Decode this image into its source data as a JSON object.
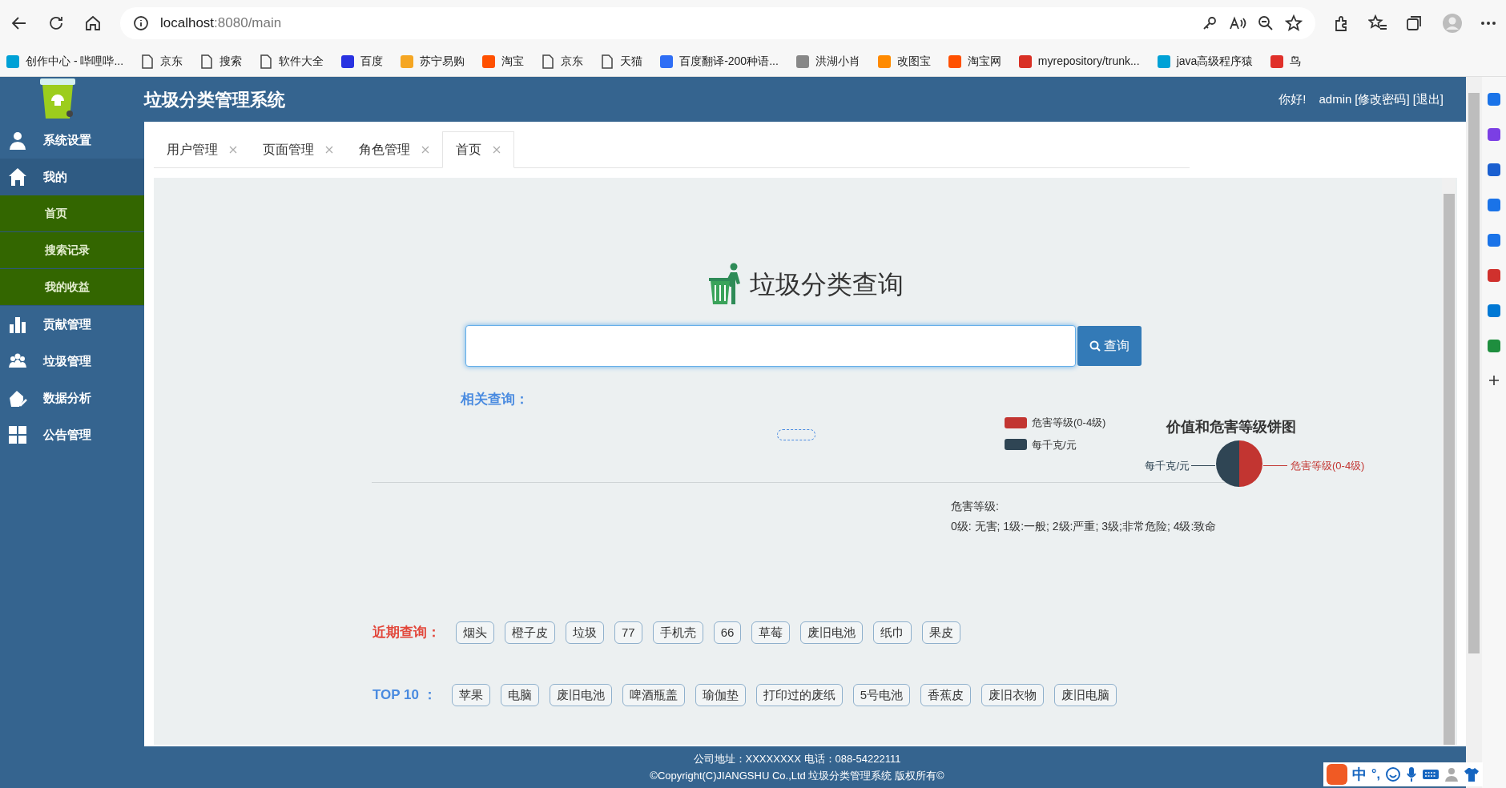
{
  "browser": {
    "url_host": "localhost",
    "url_rest": ":8080/main",
    "bookmarks": [
      {
        "label": "创作中心 - 哔哩哔...",
        "kind": "site",
        "color": "#00a1d6"
      },
      {
        "label": "京东",
        "kind": "page"
      },
      {
        "label": "搜索",
        "kind": "page"
      },
      {
        "label": "软件大全",
        "kind": "page"
      },
      {
        "label": "百度",
        "kind": "site",
        "color": "#2932e1"
      },
      {
        "label": "苏宁易购",
        "kind": "site",
        "color": "#f5a623"
      },
      {
        "label": "淘宝",
        "kind": "site",
        "color": "#ff5000"
      },
      {
        "label": "京东",
        "kind": "page"
      },
      {
        "label": "天猫",
        "kind": "page"
      },
      {
        "label": "百度翻译-200种语...",
        "kind": "site",
        "color": "#2f6ef5"
      },
      {
        "label": "洪湖小肖",
        "kind": "site",
        "color": "#888888"
      },
      {
        "label": "改图宝",
        "kind": "site",
        "color": "#ff8a00"
      },
      {
        "label": "淘宝网",
        "kind": "site",
        "color": "#ff5000"
      },
      {
        "label": "myrepository/trunk...",
        "kind": "site",
        "color": "#d93025"
      },
      {
        "label": "java高级程序猿",
        "kind": "site",
        "color": "#00a1d6"
      },
      {
        "label": "鸟",
        "kind": "site",
        "color": "#e0302a"
      }
    ]
  },
  "header": {
    "title": "垃圾分类管理系统",
    "greeting": "你好!",
    "user": "admin",
    "links": [
      "[修改密码]",
      "[退出]"
    ]
  },
  "sidebar": {
    "items": [
      {
        "label": "系统设置",
        "expanded": false
      },
      {
        "label": "我的",
        "expanded": true,
        "children": [
          {
            "label": "首页"
          },
          {
            "label": "搜索记录"
          },
          {
            "label": "我的收益"
          }
        ]
      },
      {
        "label": "贡献管理",
        "expanded": false
      },
      {
        "label": "垃圾管理",
        "expanded": false
      },
      {
        "label": "数据分析",
        "expanded": false
      },
      {
        "label": "公告管理",
        "expanded": false
      }
    ]
  },
  "tabs": [
    {
      "label": "用户管理",
      "selected": false
    },
    {
      "label": "页面管理",
      "selected": false
    },
    {
      "label": "角色管理",
      "selected": false
    },
    {
      "label": "首页",
      "selected": true
    }
  ],
  "search": {
    "title": "垃圾分类查询",
    "button": "查询"
  },
  "related": {
    "label": "相关查询："
  },
  "chart": {
    "title": "价值和危害等级饼图",
    "legend": [
      {
        "label": "危害等级(0-4级)",
        "color": "#c23531"
      },
      {
        "label": "每千克/元",
        "color": "#2f4554"
      }
    ],
    "slices": [
      {
        "label": "每千克/元",
        "color": "#2f4554"
      },
      {
        "label": "危害等级(0-4级)",
        "color": "#c23531"
      }
    ]
  },
  "hazard_note": [
    "危害等级:",
    "0级: 无害; 1级:一般; 2级:严重; 3级;非常危险; 4级:致命"
  ],
  "recent": {
    "label": "近期查询：",
    "tags": [
      "烟头",
      "橙子皮",
      "垃圾",
      "77",
      "手机壳",
      "66",
      "草莓",
      "废旧电池",
      "纸巾",
      "果皮"
    ]
  },
  "top10": {
    "label": "TOP 10 ：",
    "tags": [
      "苹果",
      "电脑",
      "废旧电池",
      "啤酒瓶盖",
      "瑜伽垫",
      "打印过的废纸",
      "5号电池",
      "香蕉皮",
      "废旧衣物",
      "废旧电脑"
    ]
  },
  "footer": [
    "公司地址：XXXXXXXX 电话：088-54222111",
    "©Copyright(C)JIANGSHU Co.,Ltd 垃圾分类管理系统 版权所有©"
  ],
  "ime": {
    "mode": "中",
    "punct": "°,"
  }
}
